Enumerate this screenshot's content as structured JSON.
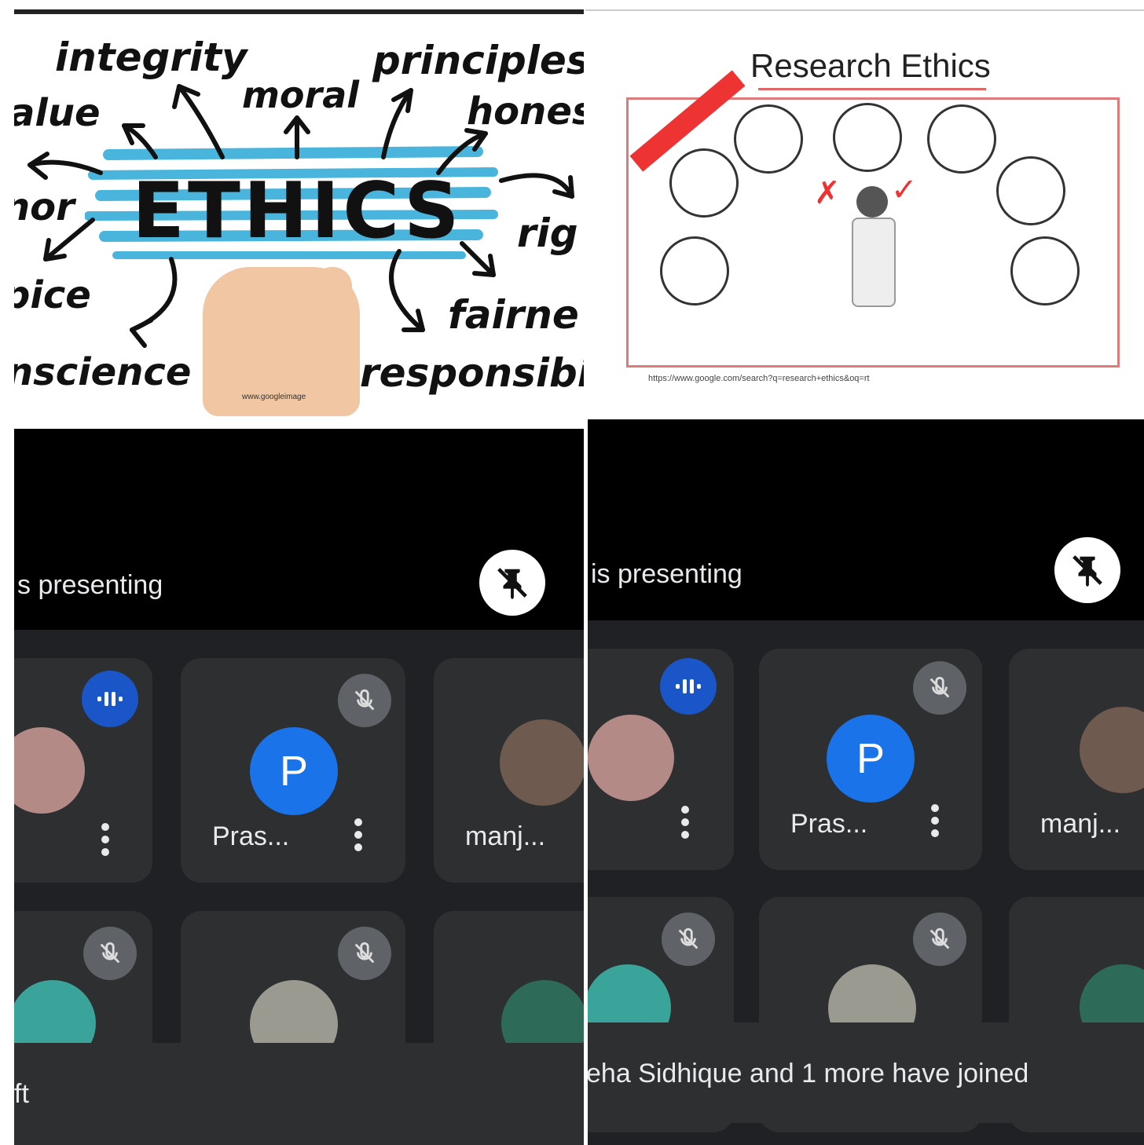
{
  "ethics_slide": {
    "center_word": "ETHICS",
    "words": [
      "integrity",
      "principles",
      "moral",
      "alue",
      "hones",
      "nor",
      "rig",
      "pice",
      "fairne",
      "nscience",
      "responsibi"
    ],
    "watermark": "www.googleimage"
  },
  "research_slide": {
    "title": "Research Ethics",
    "url": "https://www.google.com/search?q=research+ethics&oq=rt"
  },
  "meeting_left": {
    "presenting_label": "s presenting",
    "participants": [
      {
        "name": ""
      },
      {
        "name": "Pras...",
        "initial": "P"
      },
      {
        "name": "manj..."
      }
    ],
    "toast": "ft"
  },
  "meeting_right": {
    "presenting_label": "is presenting",
    "participants": [
      {
        "name": ""
      },
      {
        "name": "Pras...",
        "initial": "P"
      },
      {
        "name": "manj..."
      }
    ],
    "toast": "eha Sidhique and 1 more have joined"
  },
  "colors": {
    "accent_blue": "#1a73e8",
    "speaking_blue": "#1a56c8",
    "tile_bg": "#2d2f31",
    "grid_bg": "#202124"
  }
}
